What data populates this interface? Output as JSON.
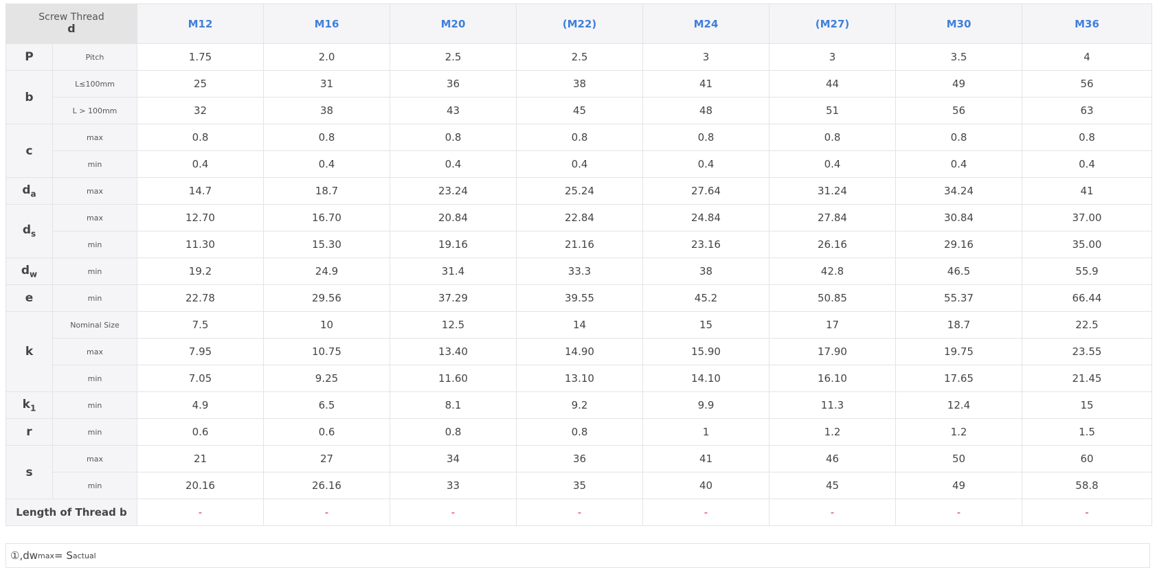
{
  "header": {
    "corner_top": "Screw Thread",
    "corner_bottom": "d",
    "sizes": [
      "M12",
      "M16",
      "M20",
      "(M22)",
      "M24",
      "(M27)",
      "M30",
      "M36"
    ]
  },
  "rows": [
    {
      "sym": "P",
      "sub": "Pitch",
      "vals": [
        "1.75",
        "2.0",
        "2.5",
        "2.5",
        "3",
        "3",
        "3.5",
        "4"
      ]
    },
    {
      "sym": "b",
      "sub": "L≤100mm",
      "vals": [
        "25",
        "31",
        "36",
        "38",
        "41",
        "44",
        "49",
        "56"
      ]
    },
    {
      "sub": "L > 100mm",
      "vals": [
        "32",
        "38",
        "43",
        "45",
        "48",
        "51",
        "56",
        "63"
      ]
    },
    {
      "sym": "c",
      "sub": "max",
      "vals": [
        "0.8",
        "0.8",
        "0.8",
        "0.8",
        "0.8",
        "0.8",
        "0.8",
        "0.8"
      ]
    },
    {
      "sub": "min",
      "vals": [
        "0.4",
        "0.4",
        "0.4",
        "0.4",
        "0.4",
        "0.4",
        "0.4",
        "0.4"
      ]
    },
    {
      "sym": "d",
      "sym_sub": "a",
      "sub": "max",
      "vals": [
        "14.7",
        "18.7",
        "23.24",
        "25.24",
        "27.64",
        "31.24",
        "34.24",
        "41"
      ]
    },
    {
      "sym": "d",
      "sym_sub": "s",
      "sub": "max",
      "vals": [
        "12.70",
        "16.70",
        "20.84",
        "22.84",
        "24.84",
        "27.84",
        "30.84",
        "37.00"
      ]
    },
    {
      "sub": "min",
      "vals": [
        "11.30",
        "15.30",
        "19.16",
        "21.16",
        "23.16",
        "26.16",
        "29.16",
        "35.00"
      ]
    },
    {
      "sym": "d",
      "sym_sub": "w",
      "sub": "min",
      "vals": [
        "19.2",
        "24.9",
        "31.4",
        "33.3",
        "38",
        "42.8",
        "46.5",
        "55.9"
      ]
    },
    {
      "sym": "e",
      "sub": "min",
      "vals": [
        "22.78",
        "29.56",
        "37.29",
        "39.55",
        "45.2",
        "50.85",
        "55.37",
        "66.44"
      ]
    },
    {
      "sym": "k",
      "sub": "Nominal Size",
      "vals": [
        "7.5",
        "10",
        "12.5",
        "14",
        "15",
        "17",
        "18.7",
        "22.5"
      ]
    },
    {
      "sub": "max",
      "vals": [
        "7.95",
        "10.75",
        "13.40",
        "14.90",
        "15.90",
        "17.90",
        "19.75",
        "23.55"
      ]
    },
    {
      "sub": "min",
      "vals": [
        "7.05",
        "9.25",
        "11.60",
        "13.10",
        "14.10",
        "16.10",
        "17.65",
        "21.45"
      ]
    },
    {
      "sym": "k",
      "sym_sub": "1",
      "sub": "min",
      "vals": [
        "4.9",
        "6.5",
        "8.1",
        "9.2",
        "9.9",
        "11.3",
        "12.4",
        "15"
      ]
    },
    {
      "sym": "r",
      "sub": "min",
      "vals": [
        "0.6",
        "0.6",
        "0.8",
        "0.8",
        "1",
        "1.2",
        "1.2",
        "1.5"
      ]
    },
    {
      "sym": "s",
      "sub": "max",
      "vals": [
        "21",
        "27",
        "34",
        "36",
        "41",
        "46",
        "50",
        "60"
      ]
    },
    {
      "sub": "min",
      "vals": [
        "20.16",
        "26.16",
        "33",
        "35",
        "40",
        "45",
        "49",
        "58.8"
      ]
    }
  ],
  "thread_length": {
    "label": "Length of Thread b",
    "vals": [
      "-",
      "-",
      "-",
      "-",
      "-",
      "-",
      "-",
      "-"
    ]
  },
  "note": {
    "prefix": "①,dw",
    "sub1": "max",
    "mid": "= S",
    "sub2": "actual"
  }
}
